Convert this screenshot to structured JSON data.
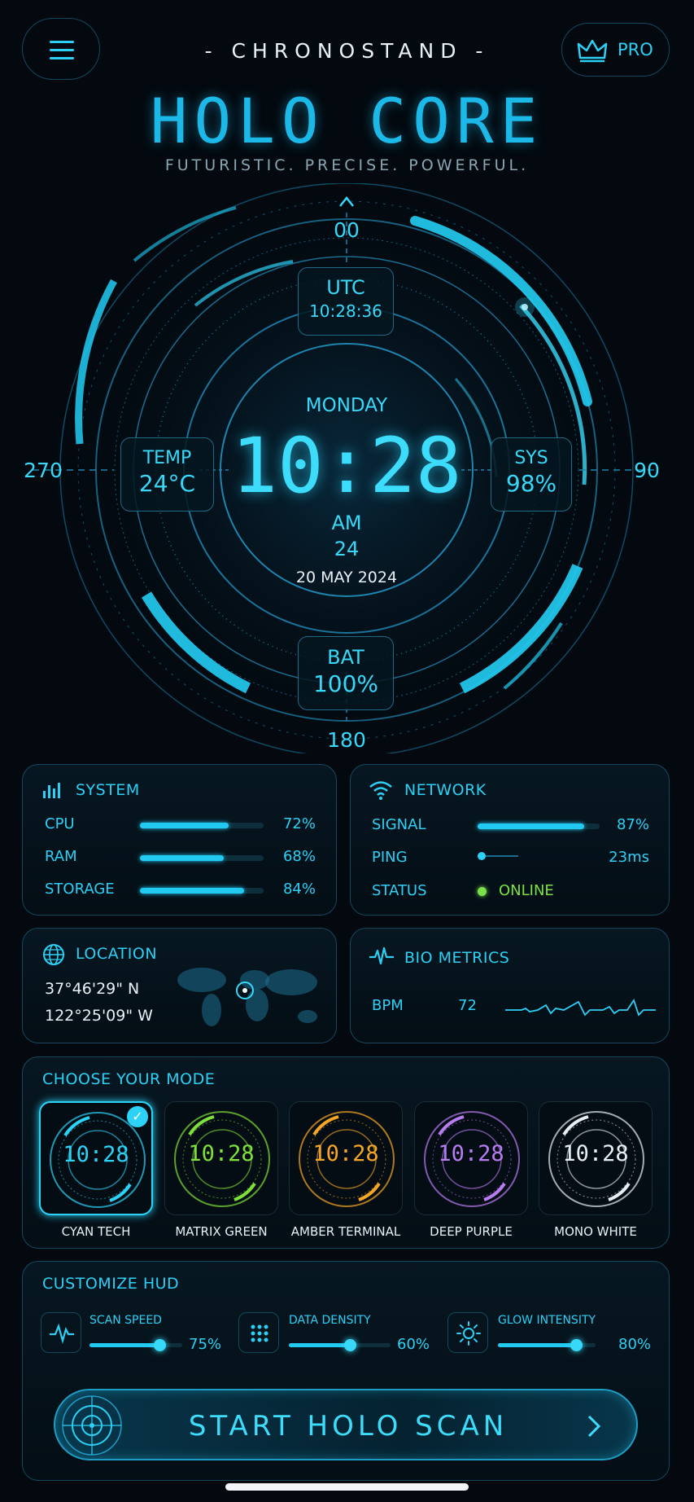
{
  "header": {
    "brand": "- CHRONOSTAND -",
    "pro_label": "PRO",
    "title": "HOLO CORE",
    "tagline": "FUTURISTIC. PRECISE. POWERFUL."
  },
  "dial": {
    "top_mark": "00",
    "right_mark": "90",
    "bottom_mark": "180",
    "left_mark": "270",
    "utc_label": "UTC",
    "utc_time": "10:28:36",
    "day": "MONDAY",
    "time": "10:28",
    "ampm": "AM",
    "seconds": "24",
    "date": "20 MAY 2024",
    "temp_label": "TEMP",
    "temp_value": "24°C",
    "sys_label": "SYS",
    "sys_value": "98%",
    "bat_label": "BAT",
    "bat_value": "100%"
  },
  "system": {
    "title": "SYSTEM",
    "rows": [
      {
        "label": "CPU",
        "value": "72%",
        "level": 0.72
      },
      {
        "label": "RAM",
        "value": "68%",
        "level": 0.68
      },
      {
        "label": "STORAGE",
        "value": "84%",
        "level": 0.84
      }
    ]
  },
  "network": {
    "title": "NETWORK",
    "signal_label": "SIGNAL",
    "signal_value": "87%",
    "signal_level": 0.87,
    "ping_label": "PING",
    "ping_value": "23ms",
    "status_label": "STATUS",
    "status_value": "ONLINE",
    "status_color": "#7be04a"
  },
  "location": {
    "title": "LOCATION",
    "lat": "37°46'29\" N",
    "lon": "122°25'09\" W"
  },
  "bio": {
    "title": "BIO METRICS",
    "bpm_label": "BPM",
    "bpm_value": "72"
  },
  "modes": {
    "title": "CHOOSE YOUR MODE",
    "items": [
      {
        "name": "CYAN TECH",
        "time": "10:28",
        "color": "#2cd3f7",
        "selected": true
      },
      {
        "name": "MATRIX GREEN",
        "time": "10:28",
        "color": "#7ee03a",
        "selected": false
      },
      {
        "name": "AMBER TERMINAL",
        "time": "10:28",
        "color": "#f5a623",
        "selected": false
      },
      {
        "name": "DEEP PURPLE",
        "time": "10:28",
        "color": "#b77cf0",
        "selected": false
      },
      {
        "name": "MONO WHITE",
        "time": "10:28",
        "color": "#e8eef2",
        "selected": false
      }
    ]
  },
  "customize": {
    "title": "CUSTOMIZE HUD",
    "sliders": [
      {
        "label": "SCAN SPEED",
        "value": "75%",
        "level": 0.75,
        "icon": "pulse-icon"
      },
      {
        "label": "DATA DENSITY",
        "value": "60%",
        "level": 0.6,
        "icon": "grid-dots-icon"
      },
      {
        "label": "GLOW INTENSITY",
        "value": "80%",
        "level": 0.8,
        "icon": "sun-icon"
      }
    ]
  },
  "cta": {
    "label": "START HOLO SCAN"
  },
  "colors": {
    "accent": "#22cdf3",
    "background": "#03090f",
    "online": "#7be04a"
  }
}
